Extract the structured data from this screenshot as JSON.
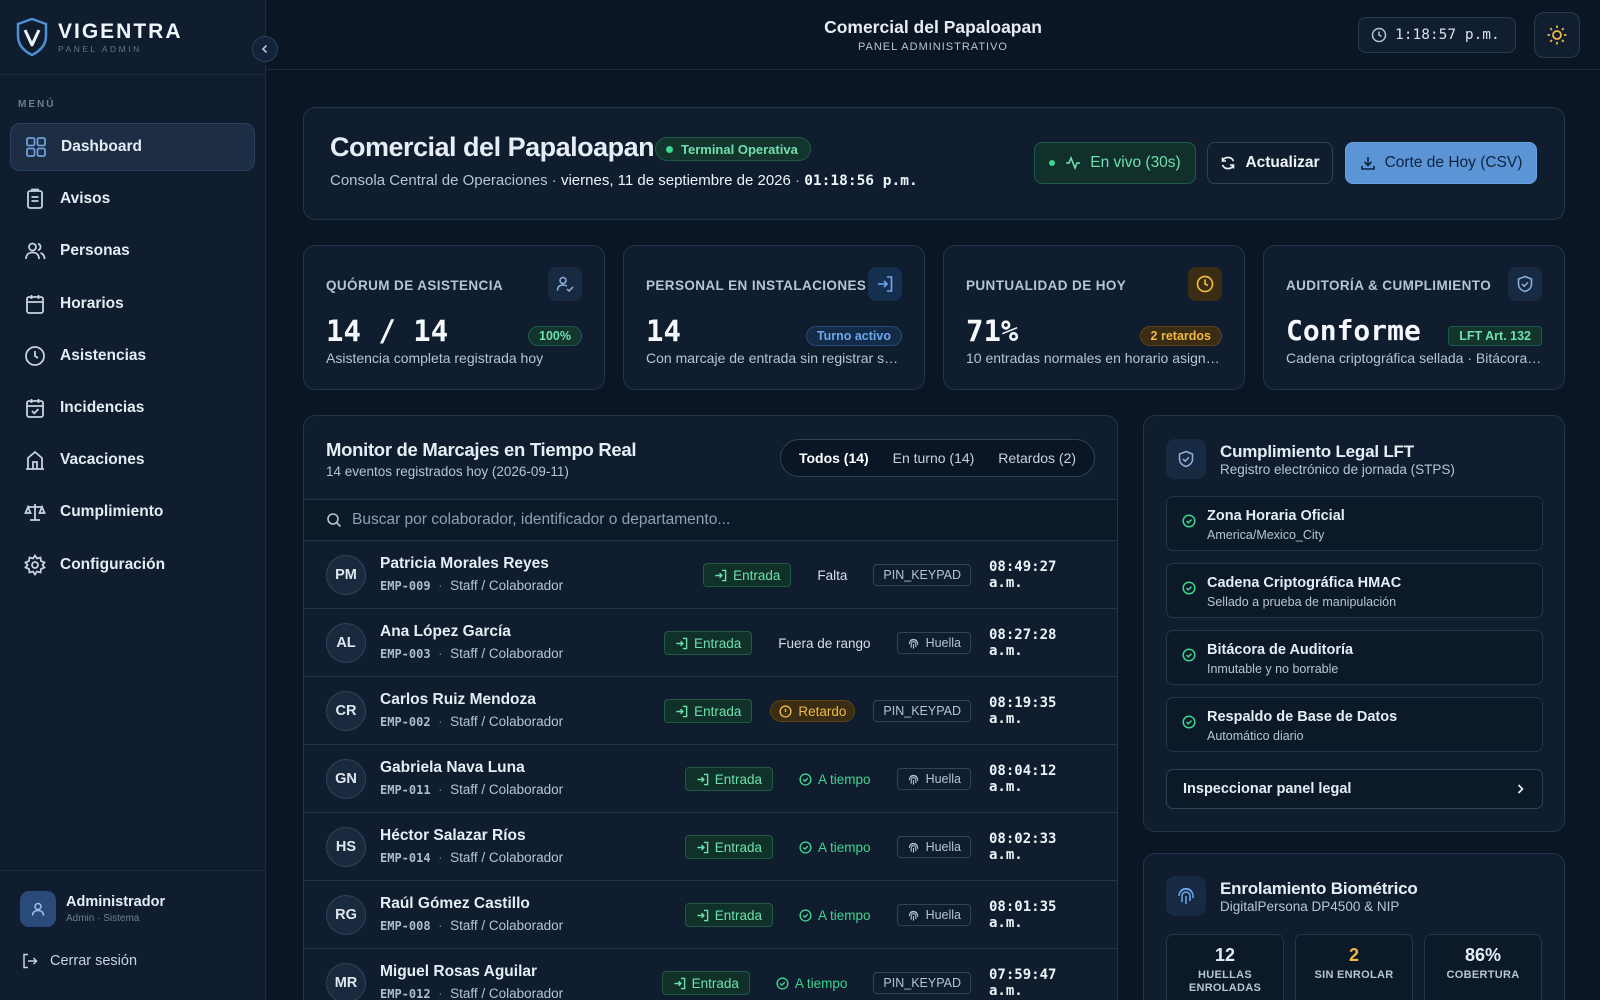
{
  "brand": {
    "name": "VIGENTRA",
    "sub": "PANEL ADMIN"
  },
  "sidebar": {
    "menu_label": "MENÚ",
    "items": [
      {
        "label": "Dashboard",
        "icon": "grid-icon"
      },
      {
        "label": "Avisos",
        "icon": "clipboard-icon"
      },
      {
        "label": "Personas",
        "icon": "users-icon"
      },
      {
        "label": "Horarios",
        "icon": "calendar-icon"
      },
      {
        "label": "Asistencias",
        "icon": "clock-icon"
      },
      {
        "label": "Incidencias",
        "icon": "calendar-check-icon"
      },
      {
        "label": "Vacaciones",
        "icon": "umbrella-icon"
      },
      {
        "label": "Cumplimiento",
        "icon": "scale-icon"
      },
      {
        "label": "Configuración",
        "icon": "gear-icon"
      }
    ],
    "user": {
      "name": "Administrador",
      "role": "Admin · Sistema"
    },
    "logout": "Cerrar sesión"
  },
  "topbar": {
    "title": "Comercial del Papaloapan",
    "subtitle": "PANEL ADMINISTRATIVO",
    "clock": "1:18:57 p.m."
  },
  "hero": {
    "title": "Comercial del Papaloapan",
    "status": "Terminal Operativa",
    "sub_prefix": "Consola Central de Operaciones ·",
    "date": "viernes, 11 de septiembre de 2026",
    "sep": "·",
    "time": "01:18:56 p.m.",
    "btn_live": "En vivo (30s)",
    "btn_refresh": "Actualizar",
    "btn_csv": "Corte de Hoy (CSV)"
  },
  "stats": [
    {
      "label": "QUÓRUM DE ASISTENCIA",
      "value": "14 / 14",
      "badge": "100%",
      "desc": "Asistencia completa registrada hoy",
      "icon": "user-check-icon"
    },
    {
      "label": "PERSONAL EN INSTALACIONES",
      "value": "14",
      "badge": "Turno activo",
      "desc": "Con marcaje de entrada sin registrar salida",
      "icon": "login-icon"
    },
    {
      "label": "PUNTUALIDAD DE HOY",
      "value": "71%",
      "badge": "2 retardos",
      "desc": "10 entradas normales en horario asignado",
      "icon": "clock-icon"
    },
    {
      "label": "AUDITORÍA & CUMPLIMIENTO",
      "value": "Conforme",
      "badge": "LFT Art. 132",
      "desc": "Cadena criptográfica sellada · Bitácora inmutable",
      "icon": "shield-icon"
    }
  ],
  "monitor": {
    "title": "Monitor de Marcajes en Tiempo Real",
    "subtitle": "14 eventos registrados hoy (2026-09-11)",
    "filters": [
      "Todos (14)",
      "En turno (14)",
      "Retardos (2)"
    ],
    "search_placeholder": "Buscar por colaborador, identificador o departamento...",
    "rows": [
      {
        "initials": "PM",
        "name": "Patricia Morales Reyes",
        "id": "EMP-009",
        "dept": "Staff / Colaborador",
        "type": "Entrada",
        "state": "Falta",
        "state_kind": "plain",
        "method": "PIN_KEYPAD",
        "time": "08:49:27 a.m."
      },
      {
        "initials": "AL",
        "name": "Ana López García",
        "id": "EMP-003",
        "dept": "Staff / Colaborador",
        "type": "Entrada",
        "state": "Fuera de rango",
        "state_kind": "plain",
        "method": "Huella",
        "time": "08:27:28 a.m."
      },
      {
        "initials": "CR",
        "name": "Carlos Ruiz Mendoza",
        "id": "EMP-002",
        "dept": "Staff / Colaborador",
        "type": "Entrada",
        "state": "Retardo",
        "state_kind": "late",
        "method": "PIN_KEYPAD",
        "time": "08:19:35 a.m."
      },
      {
        "initials": "GN",
        "name": "Gabriela Nava Luna",
        "id": "EMP-011",
        "dept": "Staff / Colaborador",
        "type": "Entrada",
        "state": "A tiempo",
        "state_kind": "ok",
        "method": "Huella",
        "time": "08:04:12 a.m."
      },
      {
        "initials": "HS",
        "name": "Héctor Salazar Ríos",
        "id": "EMP-014",
        "dept": "Staff / Colaborador",
        "type": "Entrada",
        "state": "A tiempo",
        "state_kind": "ok",
        "method": "Huella",
        "time": "08:02:33 a.m."
      },
      {
        "initials": "RG",
        "name": "Raúl Gómez Castillo",
        "id": "EMP-008",
        "dept": "Staff / Colaborador",
        "type": "Entrada",
        "state": "A tiempo",
        "state_kind": "ok",
        "method": "Huella",
        "time": "08:01:35 a.m."
      },
      {
        "initials": "MR",
        "name": "Miguel Rosas Aguilar",
        "id": "EMP-012",
        "dept": "Staff / Colaborador",
        "type": "Entrada",
        "state": "A tiempo",
        "state_kind": "ok",
        "method": "PIN_KEYPAD",
        "time": "07:59:47 a.m."
      }
    ]
  },
  "legal": {
    "title": "Cumplimiento Legal LFT",
    "subtitle": "Registro electrónico de jornada (STPS)",
    "items": [
      {
        "title": "Zona Horaria Oficial",
        "sub": "America/Mexico_City"
      },
      {
        "title": "Cadena Criptográfica HMAC",
        "sub": "Sellado a prueba de manipulación"
      },
      {
        "title": "Bitácora de Auditoría",
        "sub": "Inmutable y no borrable"
      },
      {
        "title": "Respaldo de Base de Datos",
        "sub": "Automático diario"
      }
    ],
    "inspect": "Inspeccionar panel legal"
  },
  "bio": {
    "title": "Enrolamiento Biométrico",
    "subtitle": "DigitalPersona DP4500 & NIP",
    "stats": [
      {
        "value": "12",
        "label": "HUELLAS ENROLADAS"
      },
      {
        "value": "2",
        "label": "SIN ENROLAR"
      },
      {
        "value": "86%",
        "label": "COBERTURA"
      }
    ]
  },
  "colors": {
    "accent": "#5b95d6",
    "success": "#3fd58f",
    "warning": "#f0b845",
    "bg": "#0b1624",
    "card": "#0f1d2e"
  }
}
